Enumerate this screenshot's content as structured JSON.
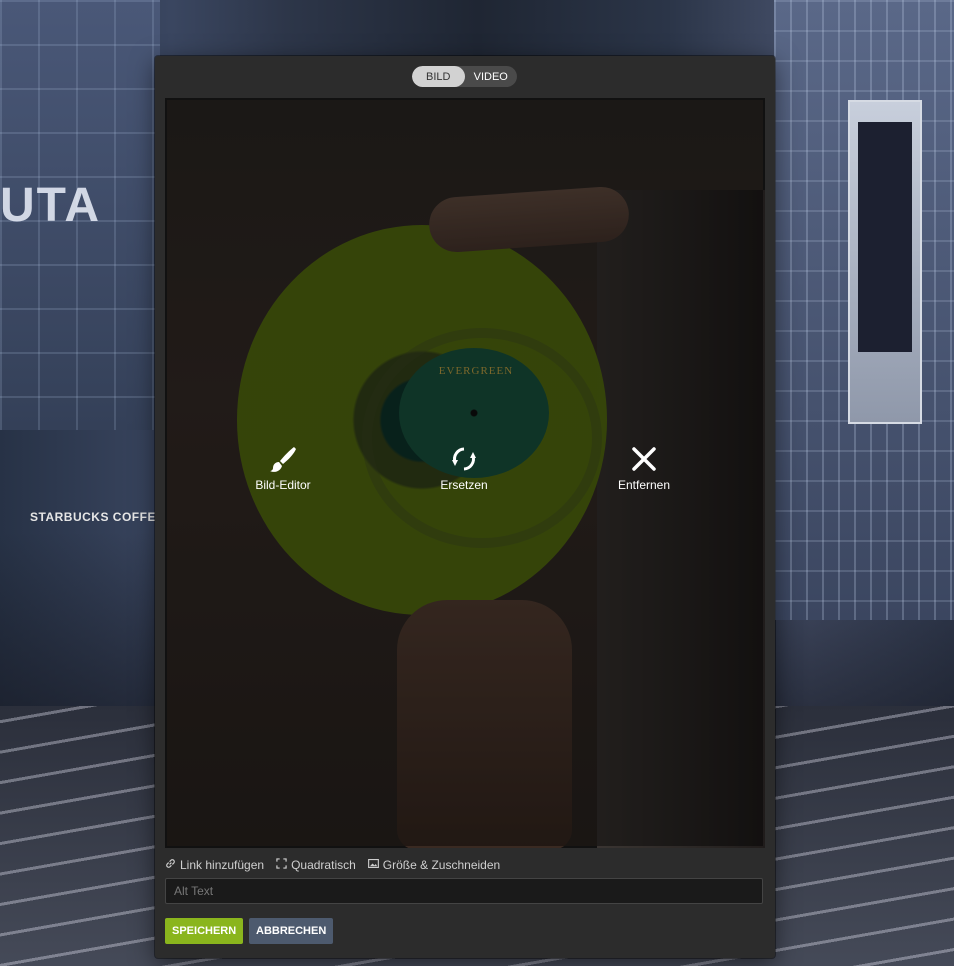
{
  "modal": {
    "tabs": [
      {
        "label": "BILD",
        "active": true
      },
      {
        "label": "VIDEO",
        "active": false
      }
    ],
    "preview": {
      "record_label_text": "EVERGREEN",
      "actions": [
        {
          "label": "Bild-Editor",
          "icon": "brush-icon"
        },
        {
          "label": "Ersetzen",
          "icon": "refresh-icon"
        },
        {
          "label": "Entfernen",
          "icon": "close-icon"
        }
      ]
    },
    "options": [
      {
        "label": "Link hinzufügen",
        "icon": "link-icon"
      },
      {
        "label": "Quadratisch",
        "icon": "crop-square-icon"
      },
      {
        "label": "Größe & Zuschneiden",
        "icon": "image-icon"
      }
    ],
    "alt_text": {
      "value": "",
      "placeholder": "Alt Text"
    },
    "buttons": {
      "save": "SPEICHERN",
      "cancel": "ABBRECHEN"
    }
  },
  "background": {
    "sign_text": "UTA",
    "shop_text": "STARBUCKS COFFEE"
  },
  "colors": {
    "accent_save": "#8ab51d",
    "cancel": "#4d5a6e",
    "modal_bg": "#2c2c2c"
  }
}
